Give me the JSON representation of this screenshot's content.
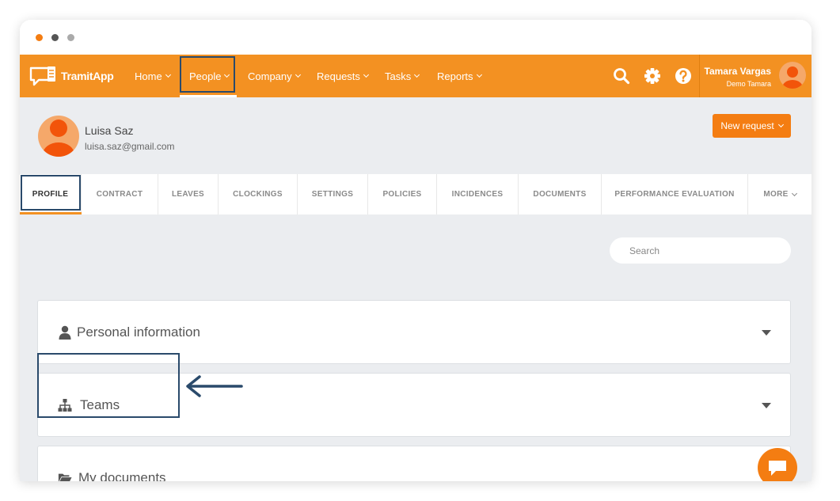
{
  "app": {
    "logo_text": "TramitApp"
  },
  "nav": {
    "items": [
      {
        "label": "Home"
      },
      {
        "label": "People"
      },
      {
        "label": "Company"
      },
      {
        "label": "Requests"
      },
      {
        "label": "Tasks"
      },
      {
        "label": "Reports"
      }
    ],
    "icons": [
      "search-icon",
      "gear-icon",
      "help-icon"
    ]
  },
  "user": {
    "name": "Tamara Vargas",
    "company": "Demo Tamara"
  },
  "employee": {
    "name": "Luisa Saz",
    "email": "luisa.saz@gmail.com"
  },
  "actions": {
    "new_request_label": "New request"
  },
  "tabs": [
    {
      "label": "PROFILE"
    },
    {
      "label": "CONTRACT"
    },
    {
      "label": "LEAVES"
    },
    {
      "label": "CLOCKINGS"
    },
    {
      "label": "SETTINGS"
    },
    {
      "label": "POLICIES"
    },
    {
      "label": "INCIDENCES"
    },
    {
      "label": "DOCUMENTS"
    },
    {
      "label": "PERFORMANCE EVALUATION"
    },
    {
      "label": "MORE"
    }
  ],
  "search": {
    "placeholder": "Search"
  },
  "sections": [
    {
      "title": "Personal information",
      "icon": "user-icon"
    },
    {
      "title": "Teams",
      "icon": "sitemap-icon"
    },
    {
      "title": "My documents",
      "icon": "folder-open-icon"
    }
  ],
  "colors": {
    "brand": "#f39122",
    "button": "#f47d12",
    "highlight": "#2a4a6b"
  }
}
